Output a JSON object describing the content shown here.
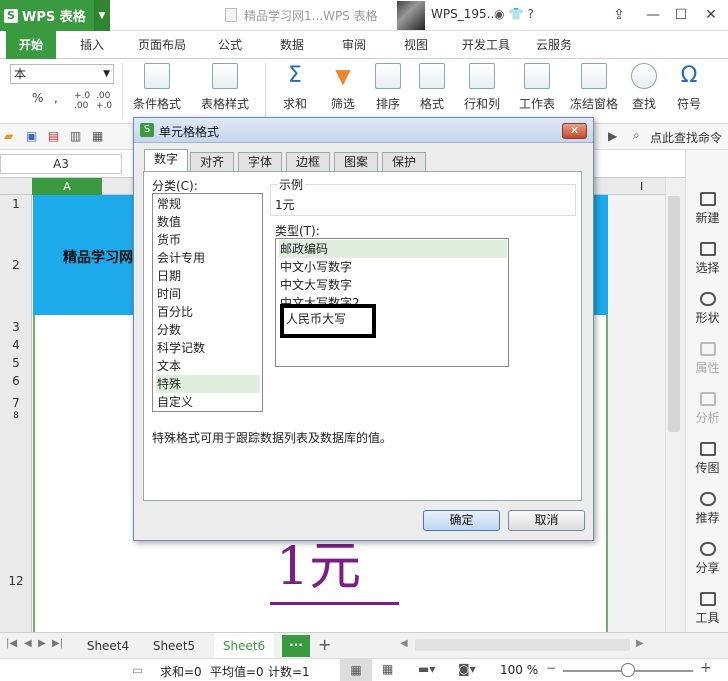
{
  "app": {
    "name": "WPS 表格",
    "document_title": "精品学习网1...WPS 表格",
    "user": "WPS_195..."
  },
  "menu_tabs": [
    "开始",
    "插入",
    "页面布局",
    "公式",
    "数据",
    "审阅",
    "视图",
    "开发工具",
    "云服务"
  ],
  "ribbon": {
    "font_name": "本",
    "small_buttons": [
      "%",
      ",",
      "+.0 .00",
      ".00 +.0"
    ],
    "buttons": [
      "条件格式",
      "表格样式",
      "求和",
      "筛选",
      "排序",
      "格式",
      "行和列",
      "工作表",
      "冻结窗格",
      "查找",
      "符号"
    ]
  },
  "quick_toolbar": {
    "find_command": "点此查找命令"
  },
  "formula_bar": {
    "name_box": "A3"
  },
  "grid": {
    "column_a": "A",
    "column_i": "I",
    "row_numbers": [
      "1",
      "2",
      "3",
      "4",
      "5",
      "6",
      "7",
      "8",
      "12"
    ],
    "header_text": "精品学习网",
    "big_value": "1元"
  },
  "right_panel": {
    "items": [
      "新建",
      "选择",
      "形状",
      "属性",
      "分析",
      "传图",
      "推荐",
      "分享",
      "工具"
    ]
  },
  "sheet_tabs": [
    "Sheet4",
    "Sheet5",
    "Sheet6"
  ],
  "active_sheet": "Sheet6",
  "statusbar": {
    "sum": "求和=0",
    "avg": "平均值=0",
    "count": "计数=1",
    "zoom": "100 %"
  },
  "dialog": {
    "title": "单元格格式",
    "tabs": [
      "数字",
      "对齐",
      "字体",
      "边框",
      "图案",
      "保护"
    ],
    "active_tab": "数字",
    "category_label": "分类(C):",
    "categories": [
      "常规",
      "数值",
      "货币",
      "会计专用",
      "日期",
      "时间",
      "百分比",
      "分数",
      "科学记数",
      "文本",
      "特殊",
      "自定义"
    ],
    "selected_category": "特殊",
    "sample_label": "示例",
    "sample_value": "1元",
    "type_label": "类型(T):",
    "types": [
      "邮政编码",
      "中文小写数字",
      "中文大写数字",
      "中文大写数字2",
      "人民币大写"
    ],
    "selected_type": "邮政编码",
    "highlighted_type": "人民币大写",
    "description": "特殊格式可用于跟踪数据列表及数据库的值。",
    "ok_label": "确定",
    "cancel_label": "取消"
  }
}
